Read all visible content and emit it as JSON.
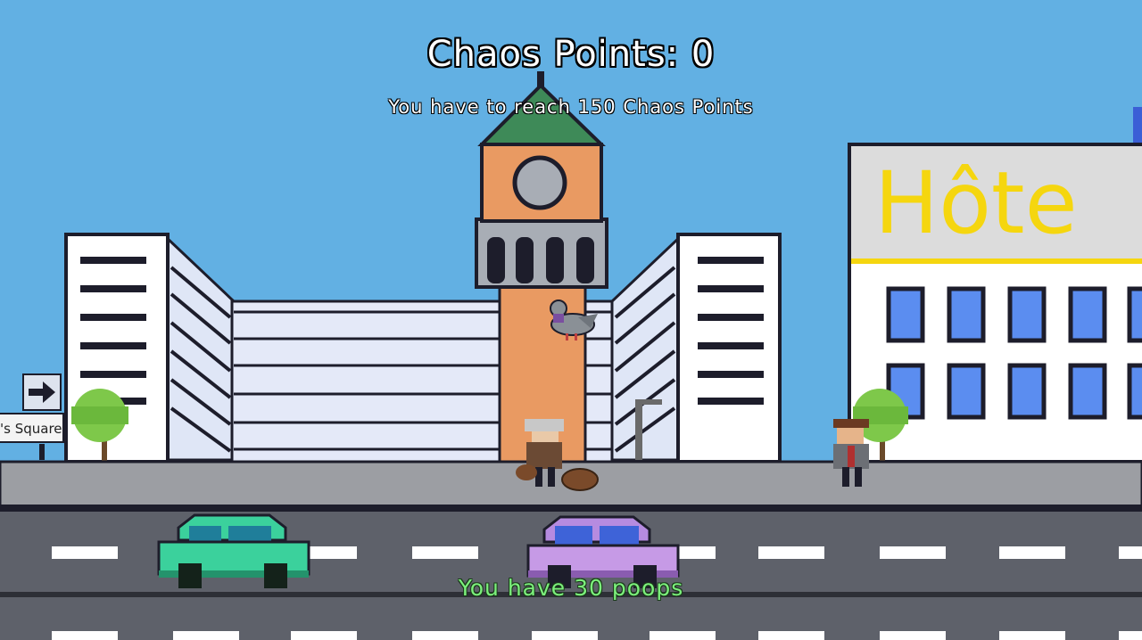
{
  "hud": {
    "score_label": "Chaos Points: 0",
    "goal_text": "You have to reach 150 Chaos Points",
    "poops_text": "You have 30 poops"
  },
  "signs": {
    "street_sign": "'s Square"
  },
  "hotel": {
    "sign_text": "Hôte"
  },
  "colors": {
    "sky": "#62b0e3",
    "road": "#5e616a",
    "sidewalk": "#9c9ea3",
    "hud_green": "#7cf07c",
    "hotel_sign": "#f5d60f"
  }
}
